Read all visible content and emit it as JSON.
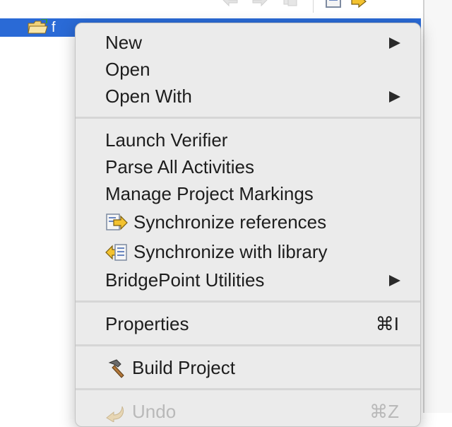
{
  "tree": {
    "selected_item_label": "f"
  },
  "menu": {
    "items": [
      {
        "label": "New",
        "submenu": true
      },
      {
        "label": "Open",
        "submenu": false
      },
      {
        "label": "Open With",
        "submenu": true
      },
      {
        "label": "Launch Verifier",
        "submenu": false
      },
      {
        "label": "Parse All Activities",
        "submenu": false
      },
      {
        "label": "Manage Project Markings",
        "submenu": false
      },
      {
        "label": "Synchronize references",
        "icon": "sync-references-icon"
      },
      {
        "label": "Synchronize with library",
        "icon": "sync-library-icon"
      },
      {
        "label": "BridgePoint Utilities",
        "submenu": true
      },
      {
        "label": "Properties",
        "shortcut": "⌘I"
      },
      {
        "label": "Build Project",
        "icon": "hammer-icon"
      },
      {
        "label": "Undo",
        "shortcut": "⌘Z",
        "disabled": true
      }
    ]
  },
  "colors": {
    "selection": "#2a6ad6",
    "menu_background": "#ebebeb",
    "disabled_text": "#b9b9b9"
  }
}
